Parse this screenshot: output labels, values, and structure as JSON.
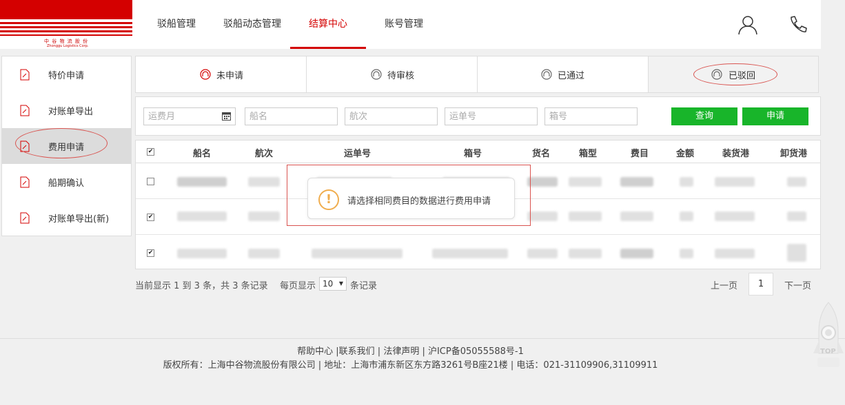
{
  "logo": {
    "text": "中 谷 物 流 股 份",
    "sub": "Zhonggu Logistics Corp."
  },
  "nav": {
    "items": [
      "驳船管理",
      "驳船动态管理",
      "结算中心",
      "账号管理"
    ],
    "active_index": 2
  },
  "header_icons": [
    "user-icon",
    "phone-icon"
  ],
  "sidebar": {
    "items": [
      "特价申请",
      "对账单导出",
      "费用申请",
      "船期确认",
      "对账单导出(新)"
    ],
    "active_index": 2
  },
  "status_tabs": {
    "items": [
      "未申请",
      "待审核",
      "已通过",
      "已驳回"
    ],
    "active_index": 3
  },
  "search": {
    "month_placeholder": "运费月",
    "ship_placeholder": "船名",
    "voyage_placeholder": "航次",
    "waybill_placeholder": "运单号",
    "container_placeholder": "箱号",
    "query_label": "查询",
    "apply_label": "申请"
  },
  "table": {
    "columns": [
      "船名",
      "航次",
      "运单号",
      "箱号",
      "货名",
      "箱型",
      "费目",
      "金额",
      "装货港",
      "卸货港"
    ],
    "rows": [
      {
        "checked": false
      },
      {
        "checked": true
      },
      {
        "checked": true
      }
    ],
    "header_checked": true
  },
  "toast": {
    "message": "请选择相同费目的数据进行费用申请",
    "icon": "warning-icon"
  },
  "pagination": {
    "info": "当前显示 1 到 3 条，共 3 条记录",
    "page_size_prefix": "每页显示",
    "page_size": "10",
    "page_size_suffix": "条记录",
    "prev": "上一页",
    "current": "1",
    "next": "下一页"
  },
  "footer": {
    "links": "帮助中心 |联系我们 | 法律声明 | 沪ICP备05055588号-1",
    "copyright": "版权所有：上海中谷物流股份有限公司 | 地址：上海市浦东新区东方路3261号B座21楼 | 电话：021-31109906,31109911"
  },
  "back_to_top": "TOP",
  "colors": {
    "brand_red": "#d40000",
    "button_green": "#18b52a",
    "warning": "#f0ad4e"
  }
}
